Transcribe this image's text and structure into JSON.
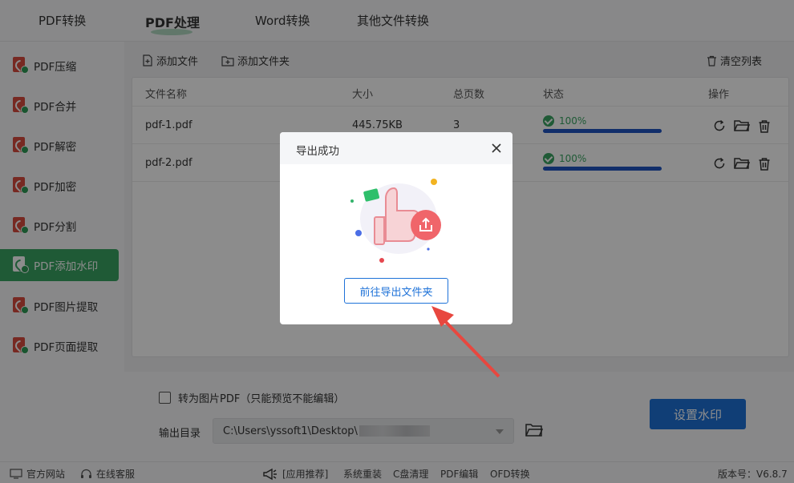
{
  "topnav": {
    "tabs": [
      {
        "label": "PDF转换"
      },
      {
        "label": "PDF处理"
      },
      {
        "label": "Word转换"
      },
      {
        "label": "其他文件转换"
      }
    ],
    "active_tab": "PDF处理"
  },
  "sidebar": {
    "items": [
      {
        "label": "PDF压缩"
      },
      {
        "label": "PDF合并"
      },
      {
        "label": "PDF解密"
      },
      {
        "label": "PDF加密"
      },
      {
        "label": "PDF分割"
      },
      {
        "label": "PDF添加水印"
      },
      {
        "label": "PDF图片提取"
      },
      {
        "label": "PDF页面提取"
      }
    ],
    "active_item": "PDF添加水印"
  },
  "toolbar": {
    "add_file": "添加文件",
    "add_folder": "添加文件夹",
    "clear_list": "清空列表"
  },
  "table": {
    "headers": {
      "name": "文件名称",
      "size": "大小",
      "pages": "总页数",
      "status": "状态",
      "actions": "操作"
    },
    "rows": [
      {
        "name": "pdf-1.pdf",
        "size": "445.75KB",
        "pages": "3",
        "progress_text": "100%",
        "progress": 1.0
      },
      {
        "name": "pdf-2.pdf",
        "size": "",
        "pages": "",
        "progress_text": "100%",
        "progress": 1.0
      }
    ]
  },
  "settings": {
    "to_image_pdf": "转为图片PDF（只能预览不能编辑）",
    "output_label": "输出目录",
    "output_path": "C:\\Users\\yssoft1\\Desktop\\",
    "set_watermark": "设置水印"
  },
  "footer": {
    "website": "官方网站",
    "support": "在线客服",
    "links": [
      "[应用推荐]",
      "系统重装",
      "C盘清理",
      "PDF编辑",
      "OFD转换"
    ],
    "version": "版本号：V6.8.7"
  },
  "modal": {
    "title": "导出成功",
    "open_folder": "前往导出文件夹"
  },
  "colors": {
    "accent_green": "#3aa563",
    "primary_blue": "#1e72d8",
    "arrow_red": "#e8473f"
  }
}
